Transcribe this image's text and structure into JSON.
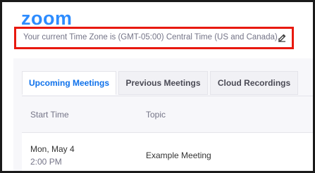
{
  "app": {
    "logo_text": "zoom",
    "brand_color": "#2d8cff"
  },
  "timezone": {
    "text": "Your current Time Zone is (GMT-05:00) Central Time (US and Canada).",
    "edit_icon": "pencil-icon",
    "highlight_color": "#e8190f"
  },
  "tabs": [
    {
      "label": "Upcoming Meetings",
      "active": true
    },
    {
      "label": "Previous Meetings",
      "active": false
    },
    {
      "label": "Cloud Recordings",
      "active": false
    }
  ],
  "table": {
    "columns": [
      "Start Time",
      "Topic"
    ],
    "rows": [
      {
        "date": "Mon, May 4",
        "time": "2:00 PM",
        "topic": "Example Meeting"
      }
    ]
  }
}
